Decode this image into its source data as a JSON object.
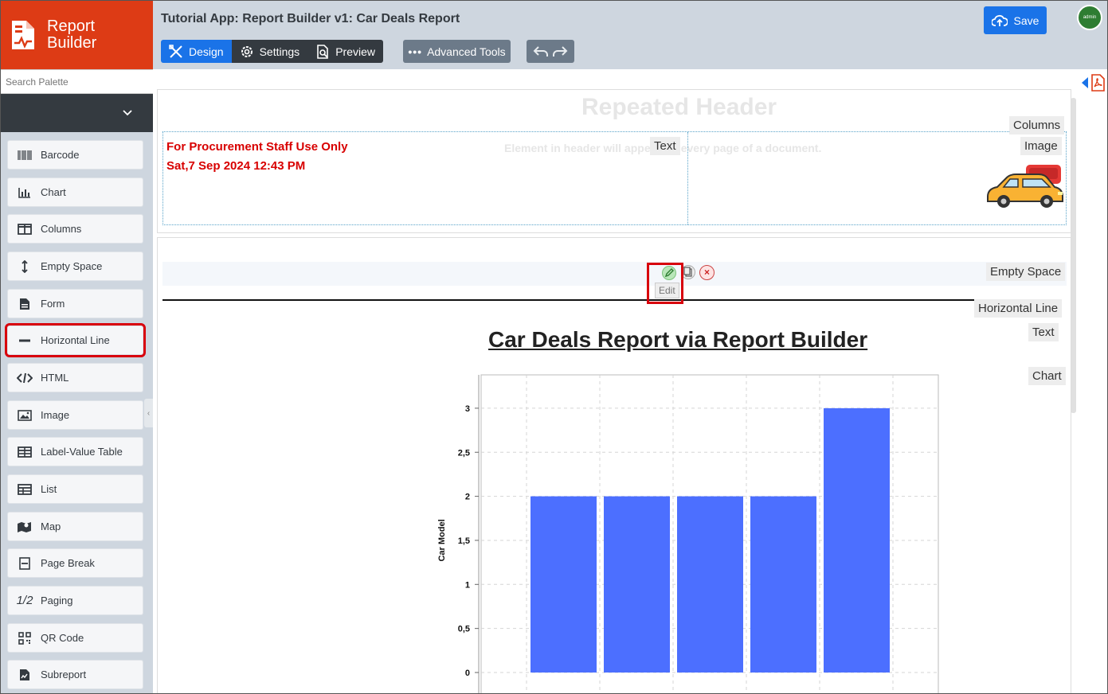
{
  "brand": {
    "line1": "Report",
    "line2": "Builder"
  },
  "topbar": {
    "title": "Tutorial App: Report Builder v1: Car Deals Report",
    "tabs": [
      {
        "label": "Design"
      },
      {
        "label": "Settings"
      },
      {
        "label": "Preview"
      }
    ],
    "advanced_tools": "Advanced Tools",
    "save": "Save",
    "avatar": "admin"
  },
  "sidebar": {
    "search_placeholder": "Search Palette",
    "items": [
      {
        "label": "Barcode",
        "icon": "barcode-icon"
      },
      {
        "label": "Chart",
        "icon": "chart-icon"
      },
      {
        "label": "Columns",
        "icon": "columns-icon"
      },
      {
        "label": "Empty Space",
        "icon": "vertical-arrows-icon"
      },
      {
        "label": "Form",
        "icon": "form-icon"
      },
      {
        "label": "Horizontal Line",
        "icon": "minus-icon"
      },
      {
        "label": "HTML",
        "icon": "code-icon"
      },
      {
        "label": "Image",
        "icon": "image-icon"
      },
      {
        "label": "Label-Value Table",
        "icon": "table-icon"
      },
      {
        "label": "List",
        "icon": "list-icon"
      },
      {
        "label": "Map",
        "icon": "map-icon"
      },
      {
        "label": "Page Break",
        "icon": "page-break-icon"
      },
      {
        "label": "Paging",
        "icon": "paging-icon",
        "glyph": "1/2"
      },
      {
        "label": "QR Code",
        "icon": "qr-code-icon"
      },
      {
        "label": "Subreport",
        "icon": "subreport-icon"
      }
    ]
  },
  "header": {
    "staff_line1": "For Procurement Staff Use Only",
    "staff_line2": "Sat,7 Sep 2024 12:43 PM",
    "ghost_title": "Repeated Header",
    "ghost_subtitle": "Element in header will appear on every page of a document.",
    "tags": {
      "text": "Text",
      "columns": "Columns",
      "image": "Image"
    }
  },
  "body": {
    "tags": {
      "empty_space": "Empty Space",
      "horizontal_line": "Horizontal Line",
      "text": "Text",
      "chart": "Chart"
    },
    "edit_tooltip": "Edit",
    "delete_glyph": "×",
    "report_title": "Car Deals Report via Report Builder"
  },
  "chart_data": {
    "type": "bar",
    "title": "",
    "xlabel": "",
    "ylabel": "Car Model",
    "categories": [
      "",
      "",
      "",
      "",
      ""
    ],
    "values": [
      2,
      2,
      2,
      2,
      3
    ],
    "ylim": [
      0,
      3.3
    ],
    "yticks": [
      0,
      0.5,
      1,
      1.5,
      2,
      2.5,
      3
    ],
    "ytick_labels": [
      "0",
      "0,5",
      "1",
      "1,5",
      "2",
      "2,5",
      "3"
    ],
    "grid": true,
    "bar_color": "#4c6fff"
  }
}
